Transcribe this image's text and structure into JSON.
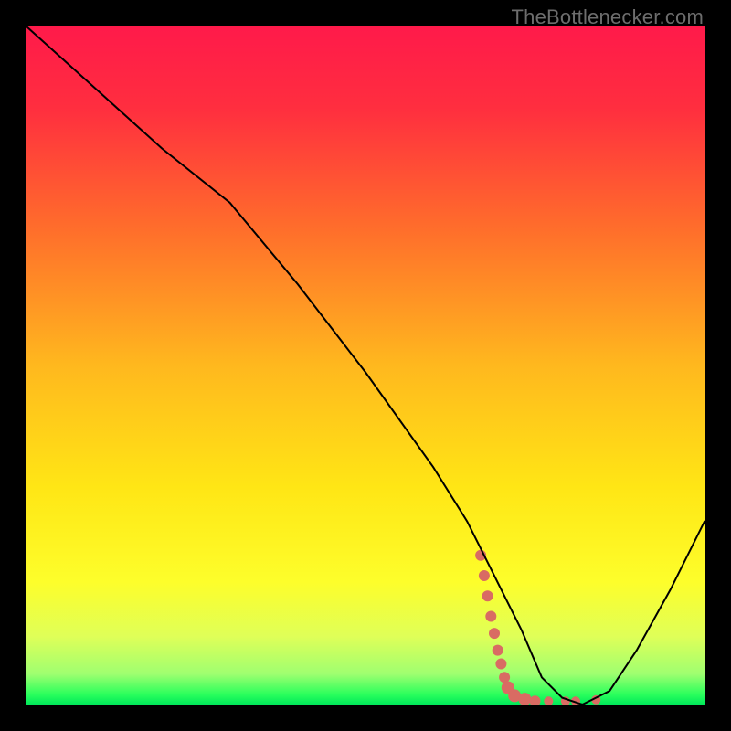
{
  "watermark": "TheBottlenecker.com",
  "gradient": {
    "stops": [
      {
        "offset": 0.0,
        "color": "#ff1a4a"
      },
      {
        "offset": 0.12,
        "color": "#ff2e3f"
      },
      {
        "offset": 0.3,
        "color": "#ff6e2b"
      },
      {
        "offset": 0.5,
        "color": "#ffb81e"
      },
      {
        "offset": 0.68,
        "color": "#ffe615"
      },
      {
        "offset": 0.82,
        "color": "#fdfe2b"
      },
      {
        "offset": 0.9,
        "color": "#dfff58"
      },
      {
        "offset": 0.955,
        "color": "#9fff70"
      },
      {
        "offset": 0.985,
        "color": "#2bff5c"
      },
      {
        "offset": 1.0,
        "color": "#00e85a"
      }
    ]
  },
  "marker_color": "#d96b63",
  "chart_data": {
    "type": "line",
    "title": "",
    "xlabel": "",
    "ylabel": "",
    "xlim": [
      0,
      100
    ],
    "ylim": [
      0,
      100
    ],
    "series": [
      {
        "name": "bottleneck-curve",
        "x": [
          0,
          10,
          20,
          30,
          40,
          50,
          60,
          65,
          67,
          70,
          73,
          76,
          79,
          82,
          86,
          90,
          95,
          100
        ],
        "y": [
          100,
          91,
          82,
          74,
          62,
          49,
          35,
          27,
          23,
          17,
          11,
          4,
          1,
          0,
          2,
          8,
          17,
          27
        ]
      }
    ],
    "markers": {
      "name": "highlighted-region",
      "points": [
        {
          "x": 67.0,
          "y": 22.0,
          "r": 6
        },
        {
          "x": 67.5,
          "y": 19.0,
          "r": 6
        },
        {
          "x": 68.0,
          "y": 16.0,
          "r": 6
        },
        {
          "x": 68.5,
          "y": 13.0,
          "r": 6
        },
        {
          "x": 69.0,
          "y": 10.5,
          "r": 6
        },
        {
          "x": 69.5,
          "y": 8.0,
          "r": 6
        },
        {
          "x": 70.0,
          "y": 6.0,
          "r": 6
        },
        {
          "x": 70.5,
          "y": 4.0,
          "r": 6
        },
        {
          "x": 71.0,
          "y": 2.5,
          "r": 7
        },
        {
          "x": 72.0,
          "y": 1.3,
          "r": 7
        },
        {
          "x": 73.5,
          "y": 0.8,
          "r": 7
        },
        {
          "x": 75.0,
          "y": 0.5,
          "r": 6
        },
        {
          "x": 77.0,
          "y": 0.5,
          "r": 5
        },
        {
          "x": 79.5,
          "y": 0.5,
          "r": 5
        },
        {
          "x": 81.0,
          "y": 0.5,
          "r": 5
        },
        {
          "x": 84.0,
          "y": 0.7,
          "r": 5
        }
      ]
    }
  }
}
